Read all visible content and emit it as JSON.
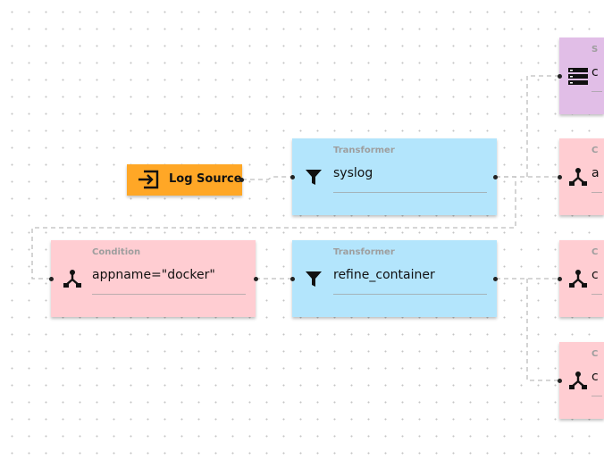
{
  "colors": {
    "source": "#FFA726",
    "transformer": "#B3E5FC",
    "condition": "#FFCDD2",
    "sink": "#E1BEE7",
    "edge": "#bdbdbd"
  },
  "nodes": {
    "log_source": {
      "label": "Log Source",
      "icon": "login-icon"
    },
    "syslog": {
      "type": "Transformer",
      "value": "syslog",
      "icon": "filter-icon"
    },
    "condition_docker": {
      "type": "Condition",
      "value": "appname=\"docker\"",
      "icon": "fork-icon"
    },
    "refine": {
      "type": "Transformer",
      "value": "refine_container",
      "icon": "filter-icon"
    },
    "right_sink": {
      "type": "S",
      "value": "c",
      "icon": "storage-icon"
    },
    "right_cond_1": {
      "type": "C",
      "value": "a",
      "icon": "fork-icon"
    },
    "right_cond_2": {
      "type": "C",
      "value": "c",
      "icon": "fork-icon"
    },
    "right_cond_3": {
      "type": "C",
      "value": "c",
      "icon": "fork-icon"
    }
  }
}
